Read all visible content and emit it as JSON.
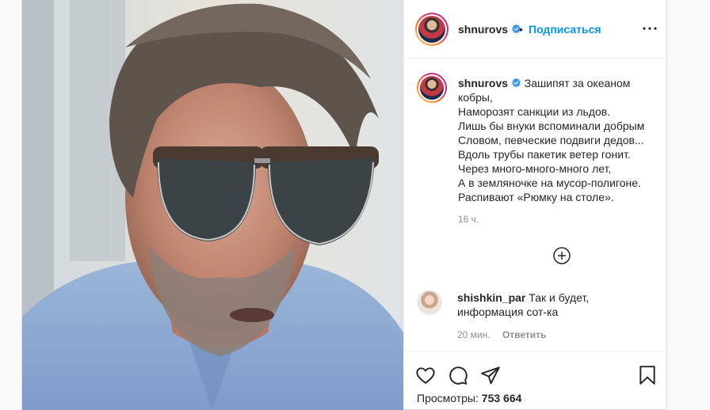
{
  "post": {
    "author": "shnurovs",
    "follow_label": "Подписаться",
    "separator": "•",
    "caption_lines": [
      "Зашипят за океаном",
      "кобры,",
      "Наморозят санкции из льдов.",
      "Лишь бы внуки вспоминали добрым",
      "Словом, певческие подвиги дедов...",
      "Вдоль трубы пакетик ветер гонит.",
      "Через много-много-много лет,",
      "А в земляночке на мусор-полигоне.",
      "Распивают «Рюмку на столе»."
    ],
    "caption_time": "16 ч.",
    "views_label": "Просмотры:",
    "views_count": "753 664"
  },
  "comment": {
    "username": "shishkin_par",
    "text_line1": "Так и будет,",
    "text_line2": "информация сот-ка",
    "time": "20 мин.",
    "reply_label": "Ответить"
  },
  "icons": {
    "verified": "verified-badge-icon",
    "more": "more-options-icon",
    "load_more": "plus-circle-icon",
    "like": "heart-icon",
    "comment": "comment-bubble-icon",
    "share": "paper-plane-icon",
    "save": "bookmark-icon"
  },
  "colors": {
    "accent": "#0095f6",
    "text": "#262626",
    "muted": "#8e8e8e"
  }
}
